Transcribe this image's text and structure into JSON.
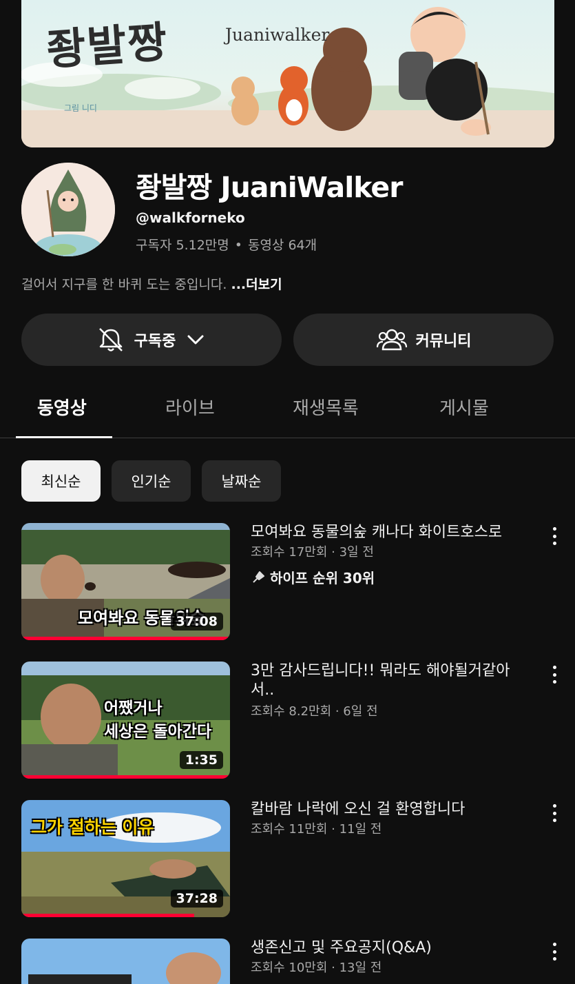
{
  "banner": {
    "logo_ko": "좡발짱",
    "logo_en": "Juaniwalker",
    "credit": "그림 니디"
  },
  "channel": {
    "name": "좡발짱 JuaniWalker",
    "handle": "@walkforneko",
    "subscribers": "구독자 5.12만명",
    "videos_count": "동영상 64개",
    "description": "걸어서 지구를 한 바퀴 도는 중입니다.",
    "more_label": "...더보기"
  },
  "buttons": {
    "subscribed": "구독중",
    "community": "커뮤니티"
  },
  "tabs": [
    {
      "label": "동영상"
    },
    {
      "label": "라이브"
    },
    {
      "label": "재생목록"
    },
    {
      "label": "게시물"
    }
  ],
  "chips": [
    {
      "label": "최신순"
    },
    {
      "label": "인기순"
    },
    {
      "label": "날짜순"
    }
  ],
  "videos": [
    {
      "title": "모여봐요 동물의숲 캐나다 화이트호스로",
      "meta": "조회수 17만회 · 3일 전",
      "hype": "하이프 순위 30위",
      "duration": "37:08",
      "overlay": "모여봐요 동물의숲",
      "progress": 1.0
    },
    {
      "title": "3만 감사드립니다!! 뭐라도 해야될거같아서..",
      "meta": "조회수 8.2만회 · 6일 전",
      "duration": "1:35",
      "overlay_line1": "어쨌거나",
      "overlay_line2": "세상은 돌아간다",
      "progress": 1.0
    },
    {
      "title": "칼바람 나락에 오신 걸 환영합니다",
      "meta": "조회수 11만회 · 11일 전",
      "duration": "37:28",
      "overlay": "그가 절하는 이유",
      "progress": 0.83
    },
    {
      "title": "생존신고 및 주요공지(Q&A)",
      "meta": "조회수 10만회 · 13일 전"
    }
  ],
  "colors": {
    "background": "#0f0f0f",
    "surface": "#272727",
    "progress": "#ff0033",
    "secondary_text": "#aaaaaa"
  },
  "icons": {
    "bell": "bell-off-icon",
    "chevron": "chevron-down-icon",
    "community": "people-icon",
    "more": "kebab-icon",
    "hype": "hype-icon"
  }
}
